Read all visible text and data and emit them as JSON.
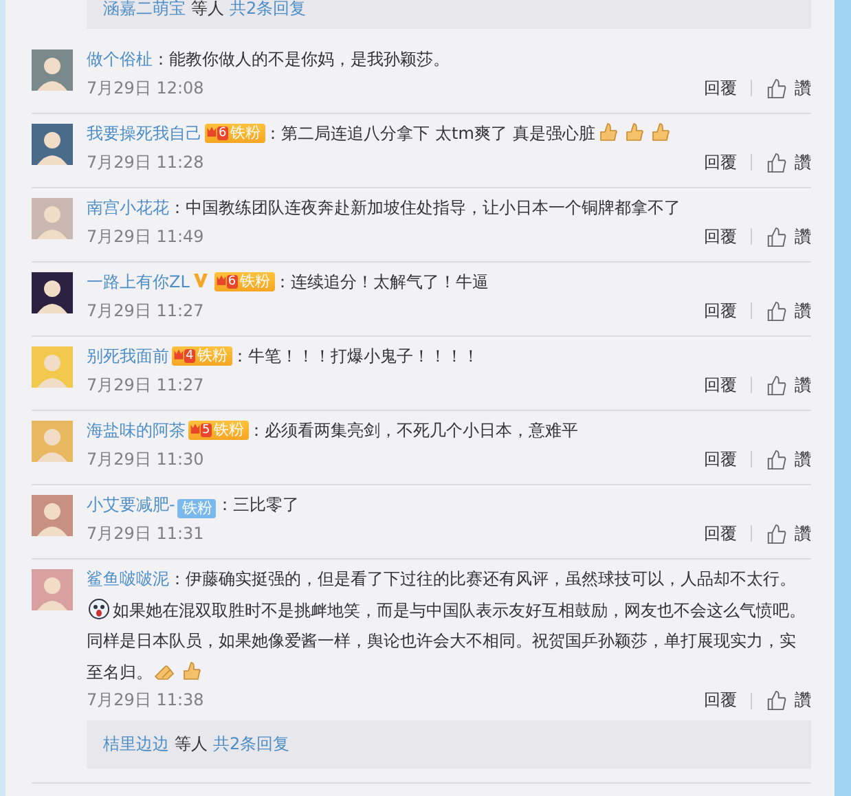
{
  "top_thread": {
    "users": "涵嘉二萌宝",
    "suffix": "等人",
    "count": "共2条回复"
  },
  "comments": [
    {
      "user": "做个俗杫",
      "verified": false,
      "segments": [
        {
          "kind": "text",
          "text": "：能教你做人的不是你妈，是我孙颖莎。"
        }
      ],
      "time": "7月29日 12:08",
      "reply": "回覆",
      "like": "讚"
    },
    {
      "user": "我要操死我自己",
      "verified": false,
      "badge": {
        "kind": "fan_level",
        "level": "6",
        "text": "铁粉"
      },
      "segments": [
        {
          "kind": "text",
          "text": "：第二局连追八分拿下 太tm爽了 真是强心脏"
        },
        {
          "kind": "thumb"
        },
        {
          "kind": "thumb"
        },
        {
          "kind": "thumb"
        }
      ],
      "time": "7月29日 11:28",
      "reply": "回覆",
      "like": "讚"
    },
    {
      "user": "南宫小花花",
      "verified": false,
      "segments": [
        {
          "kind": "text",
          "text": "：中国教练团队连夜奔赴新加坡住处指导，让小日本一个铜牌都拿不了"
        }
      ],
      "time": "7月29日 11:49",
      "reply": "回覆",
      "like": "讚"
    },
    {
      "user": "一路上有你ZL",
      "verified": true,
      "badge": {
        "kind": "fan_level",
        "level": "6",
        "text": "铁粉"
      },
      "segments": [
        {
          "kind": "text",
          "text": "：连续追分！太解气了！牛逼"
        }
      ],
      "time": "7月29日 11:27",
      "reply": "回覆",
      "like": "讚"
    },
    {
      "user": "别死我面前",
      "verified": false,
      "badge": {
        "kind": "fan_level",
        "level": "4",
        "text": "铁粉"
      },
      "segments": [
        {
          "kind": "text",
          "text": "：牛笔！！！打爆小鬼子！！！！"
        }
      ],
      "time": "7月29日 11:27",
      "reply": "回覆",
      "like": "讚"
    },
    {
      "user": "海盐味的阿茶",
      "verified": false,
      "badge": {
        "kind": "fan_level",
        "level": "5",
        "text": "铁粉"
      },
      "segments": [
        {
          "kind": "text",
          "text": "：必须看两集亮剑，不死几个小日本，意难平"
        }
      ],
      "time": "7月29日 11:30",
      "reply": "回覆",
      "like": "讚"
    },
    {
      "user": "小艾要减肥-",
      "verified": false,
      "badge": {
        "kind": "fan",
        "text": "铁粉"
      },
      "segments": [
        {
          "kind": "text",
          "text": "：三比零了"
        }
      ],
      "time": "7月29日 11:31",
      "reply": "回覆",
      "like": "讚"
    },
    {
      "user": "鲨鱼啵啵泥",
      "verified": false,
      "segments": [
        {
          "kind": "text",
          "text": "：伊藤确实挺强的，但是看了下过往的比赛还有风评，虽然球技可以，人品却不太行。"
        },
        {
          "kind": "face"
        },
        {
          "kind": "text",
          "text": "如果她在混双取胜时不是挑衅地笑，而是与中国队表示友好互相鼓励，网友也不会这么气愤吧。同样是日本队员，如果她像爱酱一样，舆论也许会大不相同。祝贺国乒孙颖莎，单打展现实力，实至名归。"
        },
        {
          "kind": "clap"
        },
        {
          "kind": "thumb"
        }
      ],
      "time": "7月29日 11:38",
      "reply": "回覆",
      "like": "讚",
      "thread": {
        "users": "桔里边边",
        "suffix": "等人",
        "count": "共2条回复"
      }
    }
  ]
}
